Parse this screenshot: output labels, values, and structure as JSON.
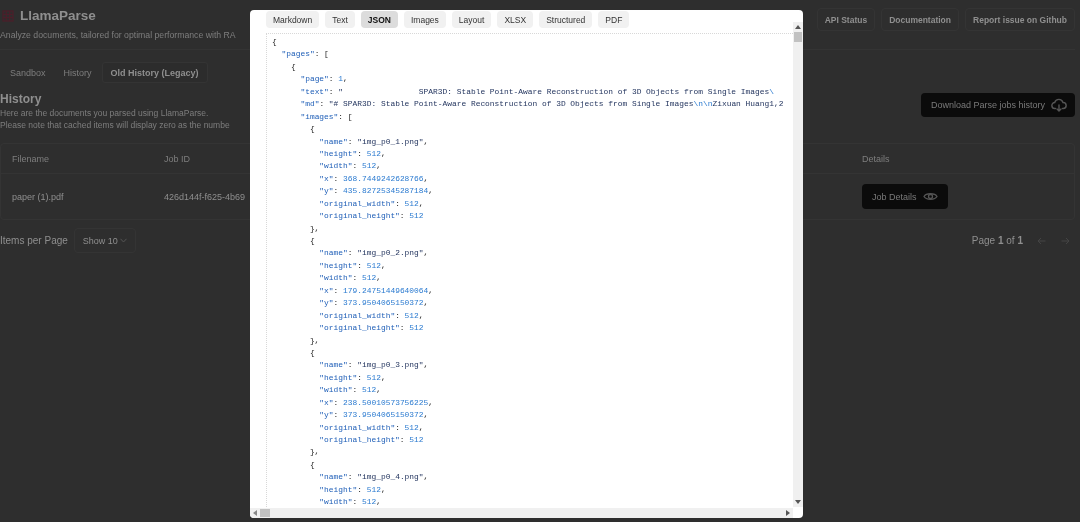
{
  "header": {
    "title": "LlamaParse",
    "subtitle": "Analyze documents, tailored for optimal performance with RA",
    "links": [
      "API Status",
      "Documentation",
      "Report issue on Github"
    ]
  },
  "tabs": [
    {
      "label": "Sandbox",
      "selected": false
    },
    {
      "label": "History",
      "selected": false
    },
    {
      "label": "Old History (Legacy)",
      "selected": true
    }
  ],
  "history": {
    "heading": "History",
    "lines": [
      "Here are the documents you parsed using LlamaParse.",
      "Please note that cached items will display zero as the numbe"
    ],
    "download_button": "Download Parse jobs history"
  },
  "table": {
    "columns": [
      "Filename",
      "Job ID",
      "Details"
    ],
    "rows": [
      {
        "filename": "paper (1).pdf",
        "job_id": "426d144f-f625-4b69",
        "details_button": "Job Details"
      }
    ]
  },
  "pagination": {
    "items_label": "Items per Page",
    "page_size": "Show 10",
    "page_prefix": "Page",
    "page_current": "1",
    "page_of": "of",
    "page_total": "1"
  },
  "modal": {
    "tabs": [
      {
        "label": "Markdown",
        "selected": false
      },
      {
        "label": "Text",
        "selected": false
      },
      {
        "label": "JSON",
        "selected": true
      },
      {
        "label": "Images",
        "selected": false
      },
      {
        "label": "Layout",
        "selected": false
      },
      {
        "label": "XLSX",
        "selected": false
      },
      {
        "label": "Structured",
        "selected": false
      },
      {
        "label": "PDF",
        "selected": false
      }
    ],
    "lines": [
      "{",
      "  \"pages\": [",
      "    {",
      "      \"page\": 1,",
      "      \"text\": \"                SPAR3D: Stable Point-Aware Reconstruction of 3D Objects from Single Images\\",
      "      \"md\": \"# SPAR3D: Stable Point-Aware Reconstruction of 3D Objects from Single Images\\n\\nZixuan Huang1,2",
      "      \"images\": [",
      "        {",
      "          \"name\": \"img_p0_1.png\",",
      "          \"height\": 512,",
      "          \"width\": 512,",
      "          \"x\": 368.7449242628766,",
      "          \"y\": 435.82725345287184,",
      "          \"original_width\": 512,",
      "          \"original_height\": 512",
      "        },",
      "        {",
      "          \"name\": \"img_p0_2.png\",",
      "          \"height\": 512,",
      "          \"width\": 512,",
      "          \"x\": 179.24751449640064,",
      "          \"y\": 373.9504065150372,",
      "          \"original_width\": 512,",
      "          \"original_height\": 512",
      "        },",
      "        {",
      "          \"name\": \"img_p0_3.png\",",
      "          \"height\": 512,",
      "          \"width\": 512,",
      "          \"x\": 238.50010573756225,",
      "          \"y\": 373.9504065150372,",
      "          \"original_width\": 512,",
      "          \"original_height\": 512",
      "        },",
      "        {",
      "          \"name\": \"img_p0_4.png\",",
      "          \"height\": 512,",
      "          \"width\": 512,"
    ]
  }
}
